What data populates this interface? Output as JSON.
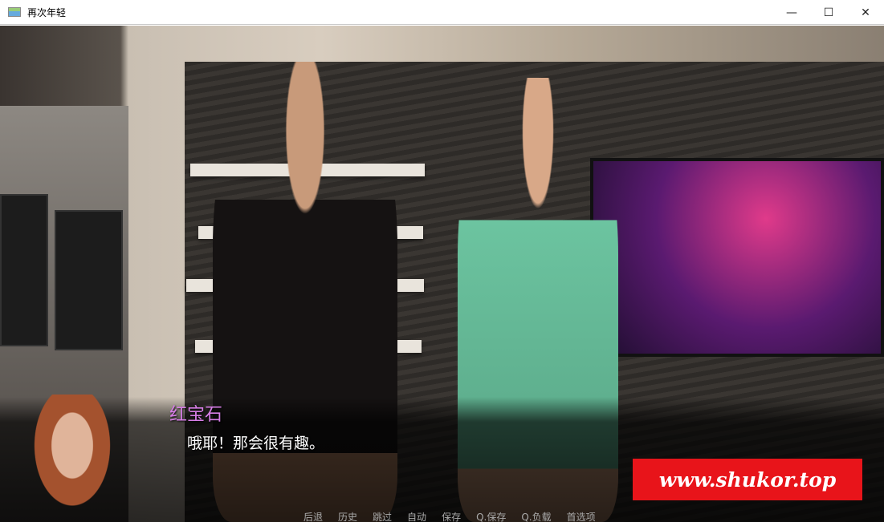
{
  "window": {
    "title": "再次年轻",
    "minimize": "—",
    "maximize": "☐",
    "close": "✕"
  },
  "dialogue": {
    "speaker": "红宝石",
    "text": "哦耶！那会很有趣。",
    "speaker_color": "#d77ee6"
  },
  "quick_menu": [
    "后退",
    "历史",
    "跳过",
    "自动",
    "保存",
    "Q.保存",
    "Q.负载",
    "首选项"
  ],
  "watermark": "www.shukor.top"
}
